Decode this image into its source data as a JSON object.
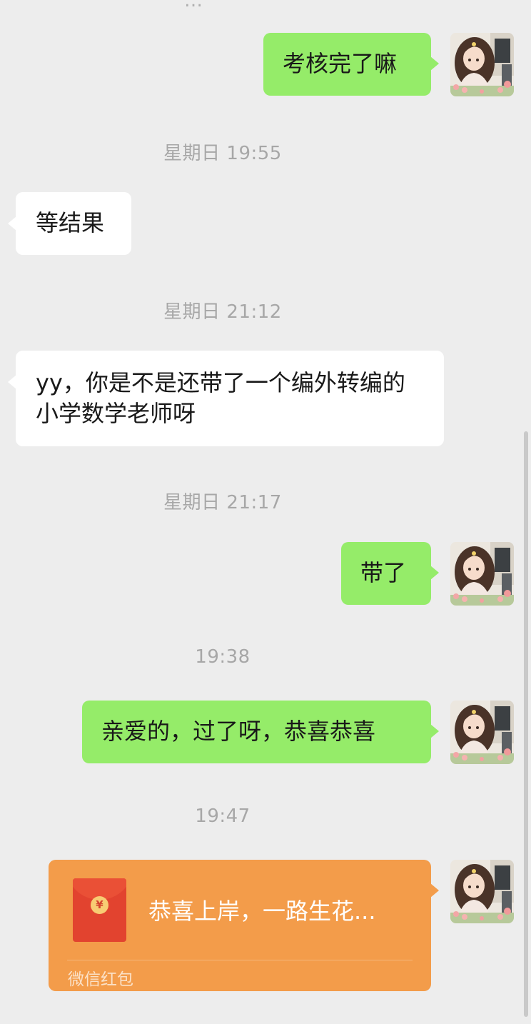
{
  "chat": {
    "top_fragment": "…",
    "messages": [
      {
        "type": "text",
        "side": "out",
        "text": "考核完了嘛"
      },
      {
        "type": "time",
        "text": "星期日 19:55"
      },
      {
        "type": "text",
        "side": "in",
        "text": "等结果"
      },
      {
        "type": "time",
        "text": "星期日 21:12"
      },
      {
        "type": "text",
        "side": "in",
        "text": "yy，你是不是还带了一个编外转编的小学数学老师呀"
      },
      {
        "type": "time",
        "text": "星期日 21:17"
      },
      {
        "type": "text",
        "side": "out",
        "text": "带了"
      },
      {
        "type": "time",
        "text": "19:38"
      },
      {
        "type": "text",
        "side": "out",
        "text": "亲爱的，过了呀，恭喜恭喜"
      },
      {
        "type": "time",
        "text": "19:47"
      },
      {
        "type": "red_packet",
        "side": "out",
        "title": "恭喜上岸，一路生花...",
        "footer": "微信红包",
        "coin_symbol": "¥"
      }
    ]
  },
  "colors": {
    "background": "#ededed",
    "outgoing_bubble": "#95ec69",
    "incoming_bubble": "#ffffff",
    "red_packet": "#f39c4a",
    "timestamp_text": "#a7a7a7"
  },
  "icons": {
    "avatar": "avatar-icon",
    "red_packet": "red-envelope-icon"
  }
}
